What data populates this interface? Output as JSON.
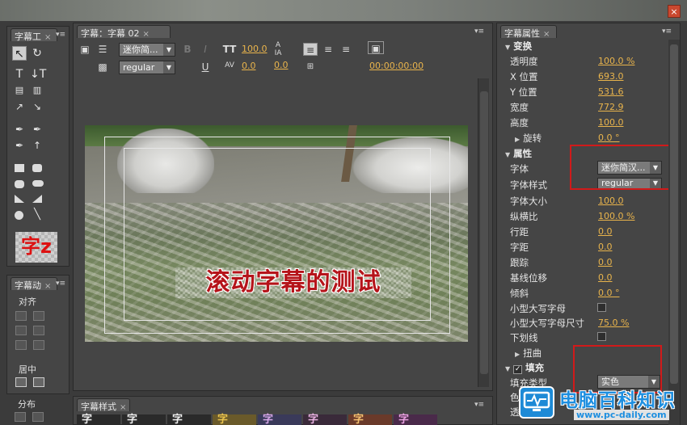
{
  "window": {
    "close_glyph": "×"
  },
  "tool_panel": {
    "tab": "字幕工",
    "preview_glyph": "字z"
  },
  "align_panel": {
    "tab": "字幕动",
    "align_label": "对齐",
    "center_label": "居中",
    "distribute_label": "分布"
  },
  "main": {
    "tab": "字幕：字幕 02",
    "font_family": "迷你简...",
    "font_style": "regular",
    "size_value": "100.0",
    "kerning_value": "0.0",
    "tracking_value": "0.0",
    "leading_value": "0.0",
    "timecode": "00:00:00:00",
    "title_text": "滚动字幕的测试"
  },
  "props": {
    "tab": "字幕属性",
    "sections": {
      "transform": "变换",
      "properties": "属性",
      "fill": "填充"
    },
    "rows": {
      "opacity": {
        "label": "透明度",
        "value": "100.0",
        "unit": "%"
      },
      "x_pos": {
        "label": "X 位置",
        "value": "693.0"
      },
      "y_pos": {
        "label": "Y 位置",
        "value": "531.6"
      },
      "width": {
        "label": "宽度",
        "value": "772.9"
      },
      "height": {
        "label": "高度",
        "value": "100.0"
      },
      "rotation": {
        "label": "旋转",
        "value": "0.0",
        "unit": "°"
      },
      "font": {
        "label": "字体",
        "value": "迷你简汉..."
      },
      "font_style": {
        "label": "字体样式",
        "value": "regular"
      },
      "font_size": {
        "label": "字体大小",
        "value": "100.0"
      },
      "aspect": {
        "label": "纵横比",
        "value": "100.0",
        "unit": "%"
      },
      "leading": {
        "label": "行距",
        "value": "0.0"
      },
      "kerning": {
        "label": "字距",
        "value": "0.0"
      },
      "tracking": {
        "label": "跟踪",
        "value": "0.0"
      },
      "baseline": {
        "label": "基线位移",
        "value": "0.0"
      },
      "slant": {
        "label": "倾斜",
        "value": "0.0",
        "unit": "°"
      },
      "small_caps": {
        "label": "小型大写字母"
      },
      "small_caps_size": {
        "label": "小型大写字母尺寸",
        "value": "75.0",
        "unit": "%"
      },
      "underline": {
        "label": "下划线"
      },
      "distort": {
        "label": "扭曲"
      },
      "fill_type": {
        "label": "填充类型",
        "value": "实色"
      },
      "color": {
        "label": "色"
      },
      "trans": {
        "label": "透"
      }
    }
  },
  "styles_panel": {
    "tab": "字幕样式",
    "swatches": [
      "字",
      "字",
      "字",
      "字",
      "字",
      "字",
      "字",
      "字"
    ]
  },
  "logo": {
    "name": "电脑百科知识",
    "url": "www.pc-daily.com"
  },
  "colors": {
    "accent": "#e9b44c",
    "highlight_box": "#d11a1a",
    "title_red": "#b5141a"
  }
}
